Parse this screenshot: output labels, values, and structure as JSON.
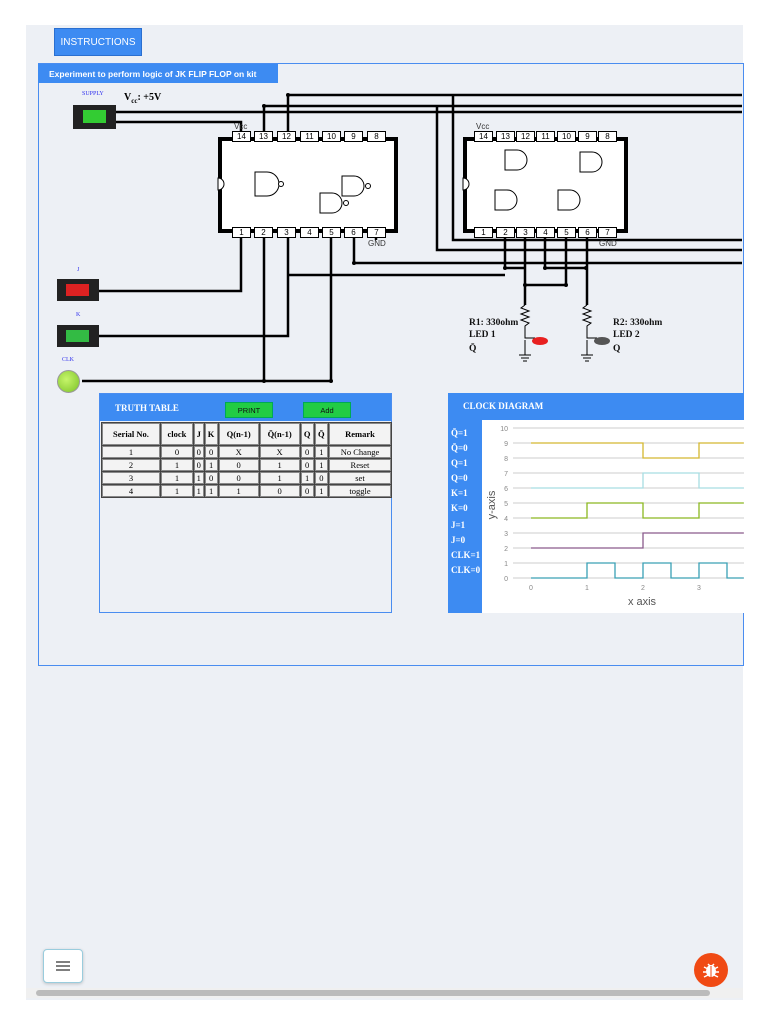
{
  "instructions_label": "INSTRUCTIONS",
  "experiment_title": "Experiment to perform logic of JK FLIP FLOP on kit",
  "supply": {
    "label": "SUPPLY",
    "vcc_label": "Vcc: +5V",
    "vcc_main": "V",
    "vcc_sub": "cc",
    "vcc_value": ": +5V"
  },
  "switches": {
    "j_label": "J",
    "k_label": "K",
    "clk_label": "CLK",
    "j_state": "off",
    "k_state": "on"
  },
  "chip1": {
    "top_pins": [
      "14",
      "13",
      "12",
      "11",
      "10",
      "9",
      "8"
    ],
    "bottom_pins": [
      "1",
      "2",
      "3",
      "4",
      "5",
      "6",
      "7"
    ],
    "vcc": "Vcc",
    "gnd": "GND"
  },
  "chip2": {
    "top_pins": [
      "14",
      "13",
      "12",
      "11",
      "10",
      "9",
      "8"
    ],
    "bottom_pins": [
      "1",
      "2",
      "3",
      "4",
      "5",
      "6",
      "7"
    ],
    "vcc": "Vcc",
    "gnd": "GND"
  },
  "leds": [
    {
      "resistor": "R1: 330ohm",
      "name": "LED 1",
      "signal": "Q̄",
      "color": "#e82020"
    },
    {
      "resistor": "R2: 330ohm",
      "name": "LED 2",
      "signal": "Q",
      "color": "#555555"
    }
  ],
  "truth_table": {
    "title": "TRUTH TABLE",
    "print_label": "PRINT",
    "add_label": "Add",
    "headers": [
      "Serial No.",
      "clock",
      "J",
      "K",
      "Q(n-1)",
      "Q̄(n-1)",
      "Q",
      "Q̄",
      "Remark"
    ],
    "rows": [
      [
        "1",
        "0",
        "0",
        "0",
        "X",
        "X",
        "0",
        "1",
        "No Change"
      ],
      [
        "2",
        "1",
        "0",
        "1",
        "0",
        "1",
        "0",
        "1",
        "Reset"
      ],
      [
        "3",
        "1",
        "1",
        "0",
        "0",
        "1",
        "1",
        "0",
        "set"
      ],
      [
        "4",
        "1",
        "1",
        "1",
        "1",
        "0",
        "0",
        "1",
        "toggle"
      ]
    ]
  },
  "clock_diagram": {
    "title": "CLOCK DIAGRAM",
    "side_labels": [
      "Q̄=1",
      "Q̄=0",
      "Q=1",
      "Q=0",
      "K=1",
      "K=0",
      "J=1",
      "J=0",
      "CLK=1",
      "CLK=0"
    ]
  },
  "chart_data": {
    "type": "line",
    "xlabel": "x axis",
    "ylabel": "y-axis",
    "ylim": [
      0,
      10
    ],
    "xlim": [
      -0.25,
      3.8
    ],
    "yticks": [
      "0",
      "1",
      "2",
      "3",
      "4",
      "5",
      "6",
      "7",
      "8",
      "9",
      "10"
    ],
    "xticks": [
      "0",
      "1",
      "2",
      "3"
    ],
    "series": [
      {
        "name": "CLK",
        "color": "#3aa0b5",
        "x": [
          0,
          1,
          1,
          1.5,
          1.5,
          2,
          2,
          2.5,
          2.5,
          3,
          3,
          3.5,
          3.5,
          3.8
        ],
        "y": [
          0,
          0,
          1,
          1,
          0,
          0,
          1,
          1,
          0,
          0,
          1,
          1,
          0,
          0
        ]
      },
      {
        "name": "J",
        "color": "#8a5a8c",
        "x": [
          0,
          2,
          2,
          3.8
        ],
        "y": [
          2,
          2,
          3,
          3
        ]
      },
      {
        "name": "K",
        "color": "#8cb820",
        "x": [
          0,
          1,
          1,
          2,
          2,
          3,
          3,
          3.8
        ],
        "y": [
          4,
          4,
          5,
          5,
          4,
          4,
          5,
          5
        ]
      },
      {
        "name": "Q",
        "color": "#a8dde2",
        "x": [
          0,
          2,
          2,
          3,
          3,
          3.8
        ],
        "y": [
          6,
          6,
          7,
          7,
          6,
          6
        ]
      },
      {
        "name": "Q̄",
        "color": "#d4b830",
        "x": [
          0,
          2,
          2,
          3,
          3,
          3.8
        ],
        "y": [
          9,
          9,
          8,
          8,
          9,
          9
        ]
      }
    ]
  }
}
